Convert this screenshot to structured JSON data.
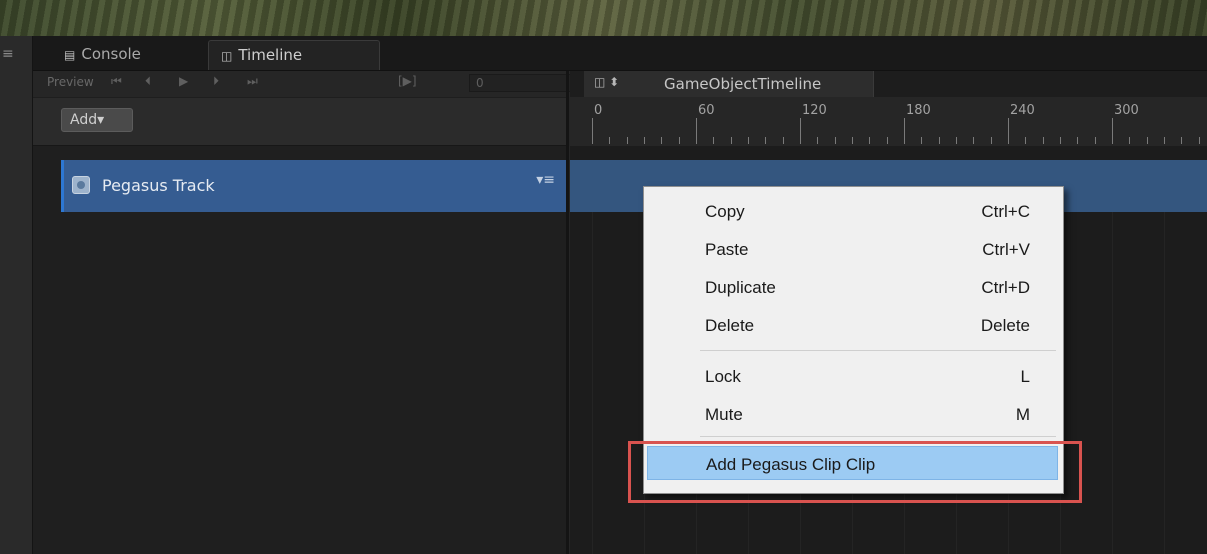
{
  "tabs": {
    "console": "Console",
    "timeline": "Timeline"
  },
  "preview": {
    "label": "Preview",
    "frame": "0",
    "controls": [
      "⏮",
      "⏴",
      "▶",
      "⏵",
      "⏭",
      "[▶]"
    ]
  },
  "toolbar": {
    "add_label": "Add▾"
  },
  "timeline_asset": {
    "name": "GameObjectTimeline",
    "icon_glyph": "◫ ⬍"
  },
  "track": {
    "name": "Pegasus Track",
    "menu_glyph": "▾≡",
    "color": "#355c91"
  },
  "ruler": {
    "labels": [
      "0",
      "60",
      "120",
      "180",
      "240",
      "300"
    ]
  },
  "context_menu": {
    "items": [
      {
        "label": "Copy",
        "shortcut": "Ctrl+C"
      },
      {
        "label": "Paste",
        "shortcut": "Ctrl+V"
      },
      {
        "label": "Duplicate",
        "shortcut": "Ctrl+D"
      },
      {
        "label": "Delete",
        "shortcut": "Delete"
      },
      {
        "label": "Lock",
        "shortcut": "L"
      },
      {
        "label": "Mute",
        "shortcut": "M"
      },
      {
        "label": "Add Pegasus Clip Clip",
        "shortcut": ""
      }
    ],
    "highlight_color": "#9ccbf3",
    "annotation_color": "#d9534f"
  }
}
